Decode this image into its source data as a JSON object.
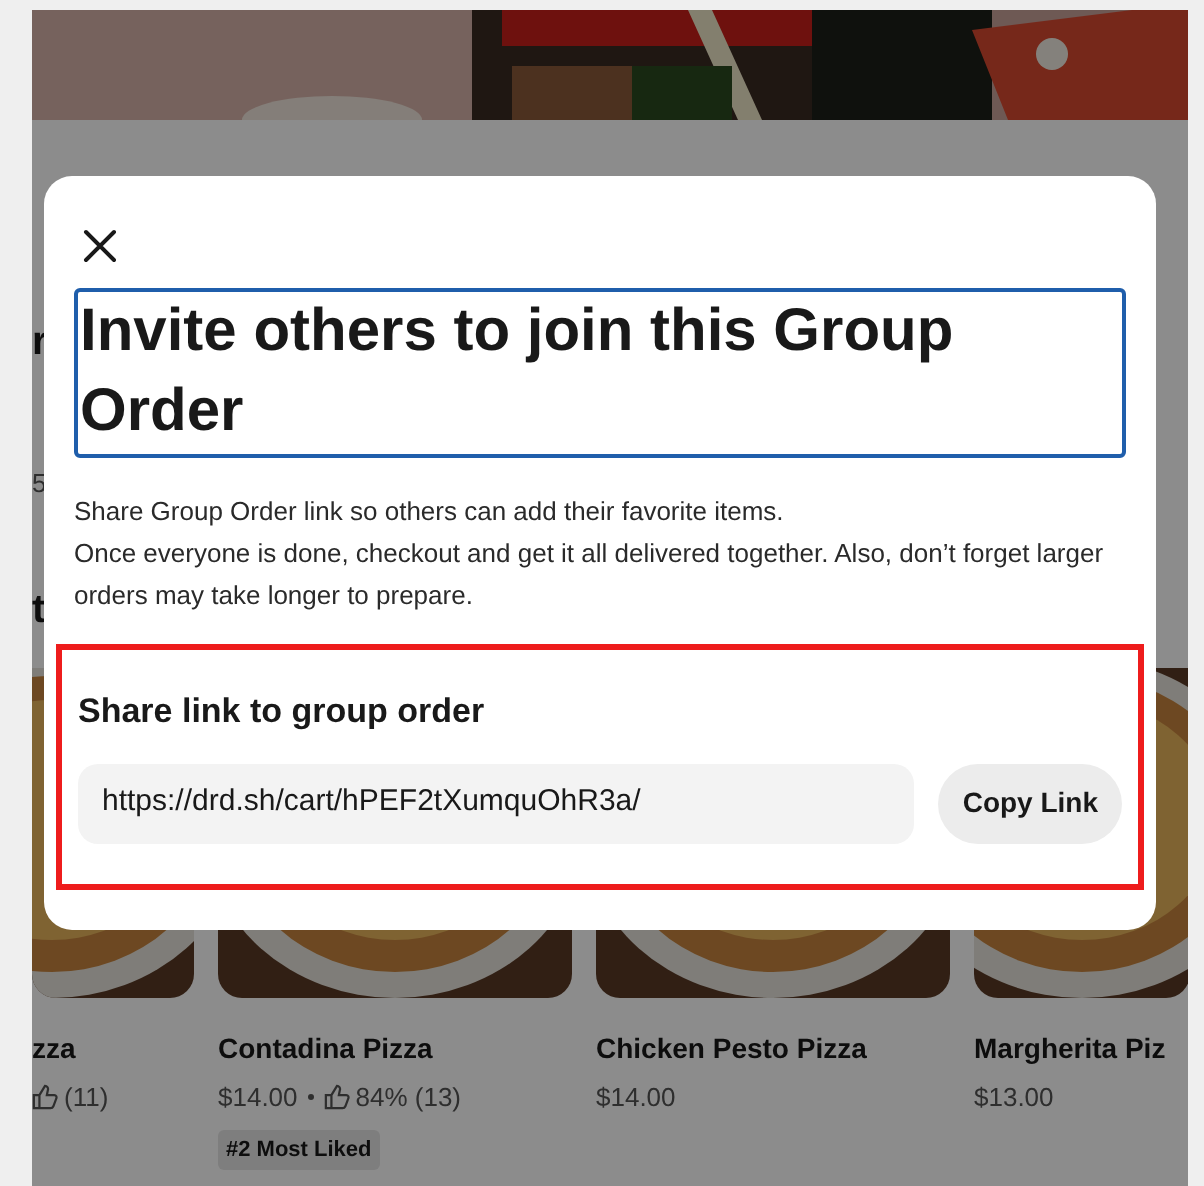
{
  "background_page": {
    "fragments": [
      {
        "text": "r",
        "kind": "heading"
      },
      {
        "text": "5",
        "kind": "plain"
      },
      {
        "text": "t",
        "kind": "heading"
      }
    ],
    "menu_items": [
      {
        "name": "zza",
        "rating": "(11)"
      },
      {
        "name": "Contadina Pizza",
        "price": "$14.00",
        "rating": "84% (13)",
        "badge": "#2 Most Liked"
      },
      {
        "name": "Chicken Pesto Pizza",
        "price": "$14.00"
      },
      {
        "name": "Margherita Piz",
        "price": "$13.00"
      }
    ]
  },
  "dialog": {
    "title": "Invite others to join this Group Order",
    "title_focused": true,
    "description": [
      "Share Group Order link so others can add their favorite items.",
      "Once everyone is done, checkout and get it all delivered together. Also, don’t forget larger orders may take longer to prepare."
    ],
    "share_section": {
      "highlighted": true,
      "heading": "Share link to group order",
      "link": "https://drd.sh/cart/hPEF2tXumquOhR3a/",
      "button": "Copy Link"
    }
  }
}
